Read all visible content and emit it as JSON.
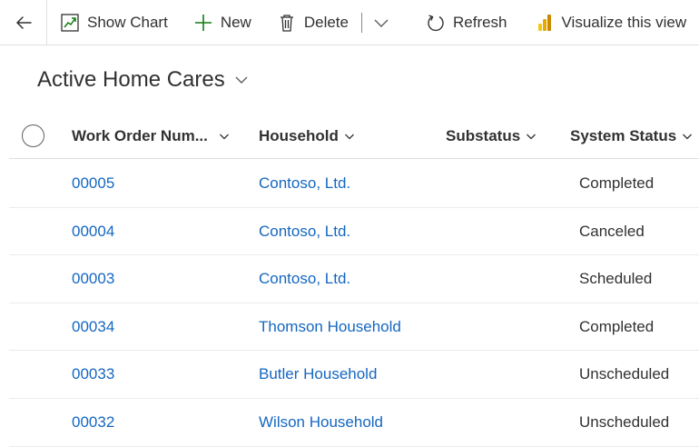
{
  "commands": {
    "show_chart": "Show Chart",
    "new": "New",
    "delete": "Delete",
    "refresh": "Refresh",
    "visualize": "Visualize this view"
  },
  "view": {
    "title": "Active Home Cares"
  },
  "columns": {
    "work_order": "Work Order Num...",
    "household": "Household",
    "substatus": "Substatus",
    "system_status": "System Status"
  },
  "rows": [
    {
      "work_order": "00005",
      "household": "Contoso, Ltd.",
      "substatus": "",
      "system_status": "Completed"
    },
    {
      "work_order": "00004",
      "household": "Contoso, Ltd.",
      "substatus": "",
      "system_status": "Canceled"
    },
    {
      "work_order": "00003",
      "household": "Contoso, Ltd.",
      "substatus": "",
      "system_status": "Scheduled"
    },
    {
      "work_order": "00034",
      "household": "Thomson Household",
      "substatus": "",
      "system_status": "Completed"
    },
    {
      "work_order": "00033",
      "household": "Butler Household",
      "substatus": "",
      "system_status": "Unscheduled"
    },
    {
      "work_order": "00032",
      "household": "Wilson Household",
      "substatus": "",
      "system_status": "Unscheduled"
    }
  ],
  "colors": {
    "link": "#1567c0",
    "accent_green": "#107c10",
    "powerbi": "#f2c811"
  }
}
